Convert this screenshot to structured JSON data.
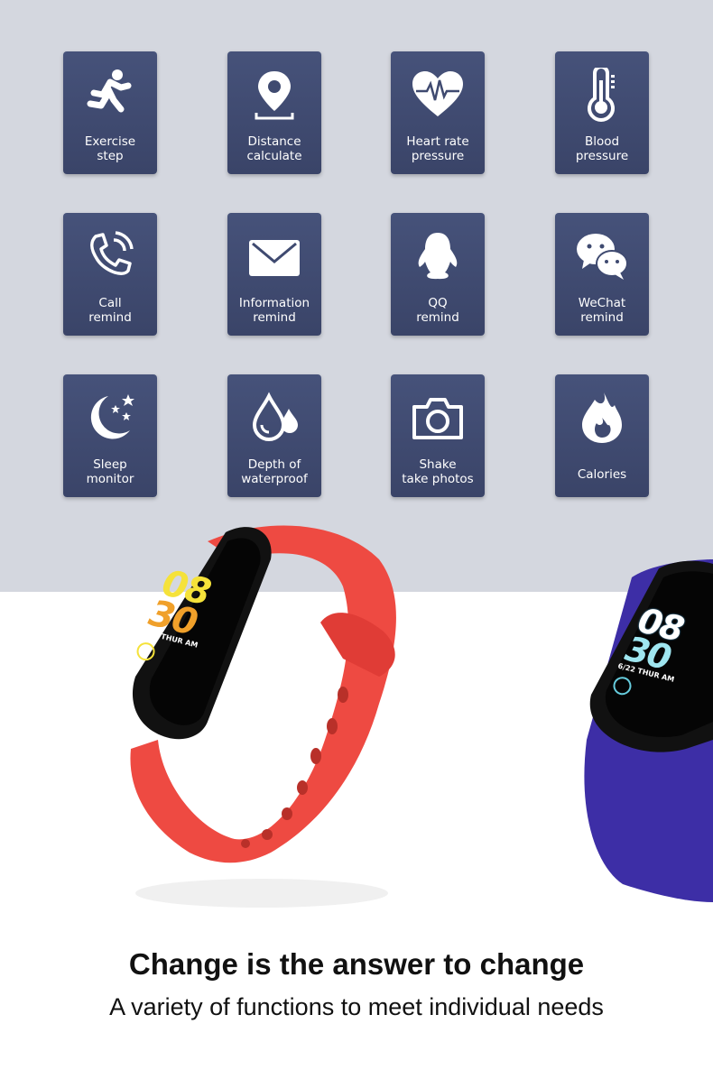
{
  "features": [
    {
      "icon": "running-person-icon",
      "line1": "Exercise",
      "line2": "step"
    },
    {
      "icon": "location-pin-icon",
      "line1": "Distance",
      "line2": "calculate"
    },
    {
      "icon": "heart-rate-icon",
      "line1": "Heart rate",
      "line2": "pressure"
    },
    {
      "icon": "thermometer-icon",
      "line1": "Blood",
      "line2": "pressure"
    },
    {
      "icon": "phone-call-icon",
      "line1": "Call",
      "line2": "remind"
    },
    {
      "icon": "envelope-icon",
      "line1": "Information",
      "line2": "remind"
    },
    {
      "icon": "qq-penguin-icon",
      "line1": "QQ",
      "line2": "remind"
    },
    {
      "icon": "wechat-icon",
      "line1": "WeChat",
      "line2": "remind"
    },
    {
      "icon": "moon-stars-icon",
      "line1": "Sleep",
      "line2": "monitor"
    },
    {
      "icon": "water-drops-icon",
      "line1": "Depth of",
      "line2": "waterproof"
    },
    {
      "icon": "camera-icon",
      "line1": "Shake",
      "line2": "take photos"
    },
    {
      "icon": "flame-icon",
      "line1": "Calories",
      "line2": ""
    }
  ],
  "watch": {
    "hour": "08",
    "minute": "30",
    "date": "6/22 THUR AM"
  },
  "colors": {
    "tile": "#3f4a70",
    "background_top": "#d4d7df",
    "band_red": "#ef4f45",
    "band_purple": "#3f2fa8"
  },
  "headline": "Change is the answer to change",
  "subheadline": "A variety of functions to meet individual needs"
}
